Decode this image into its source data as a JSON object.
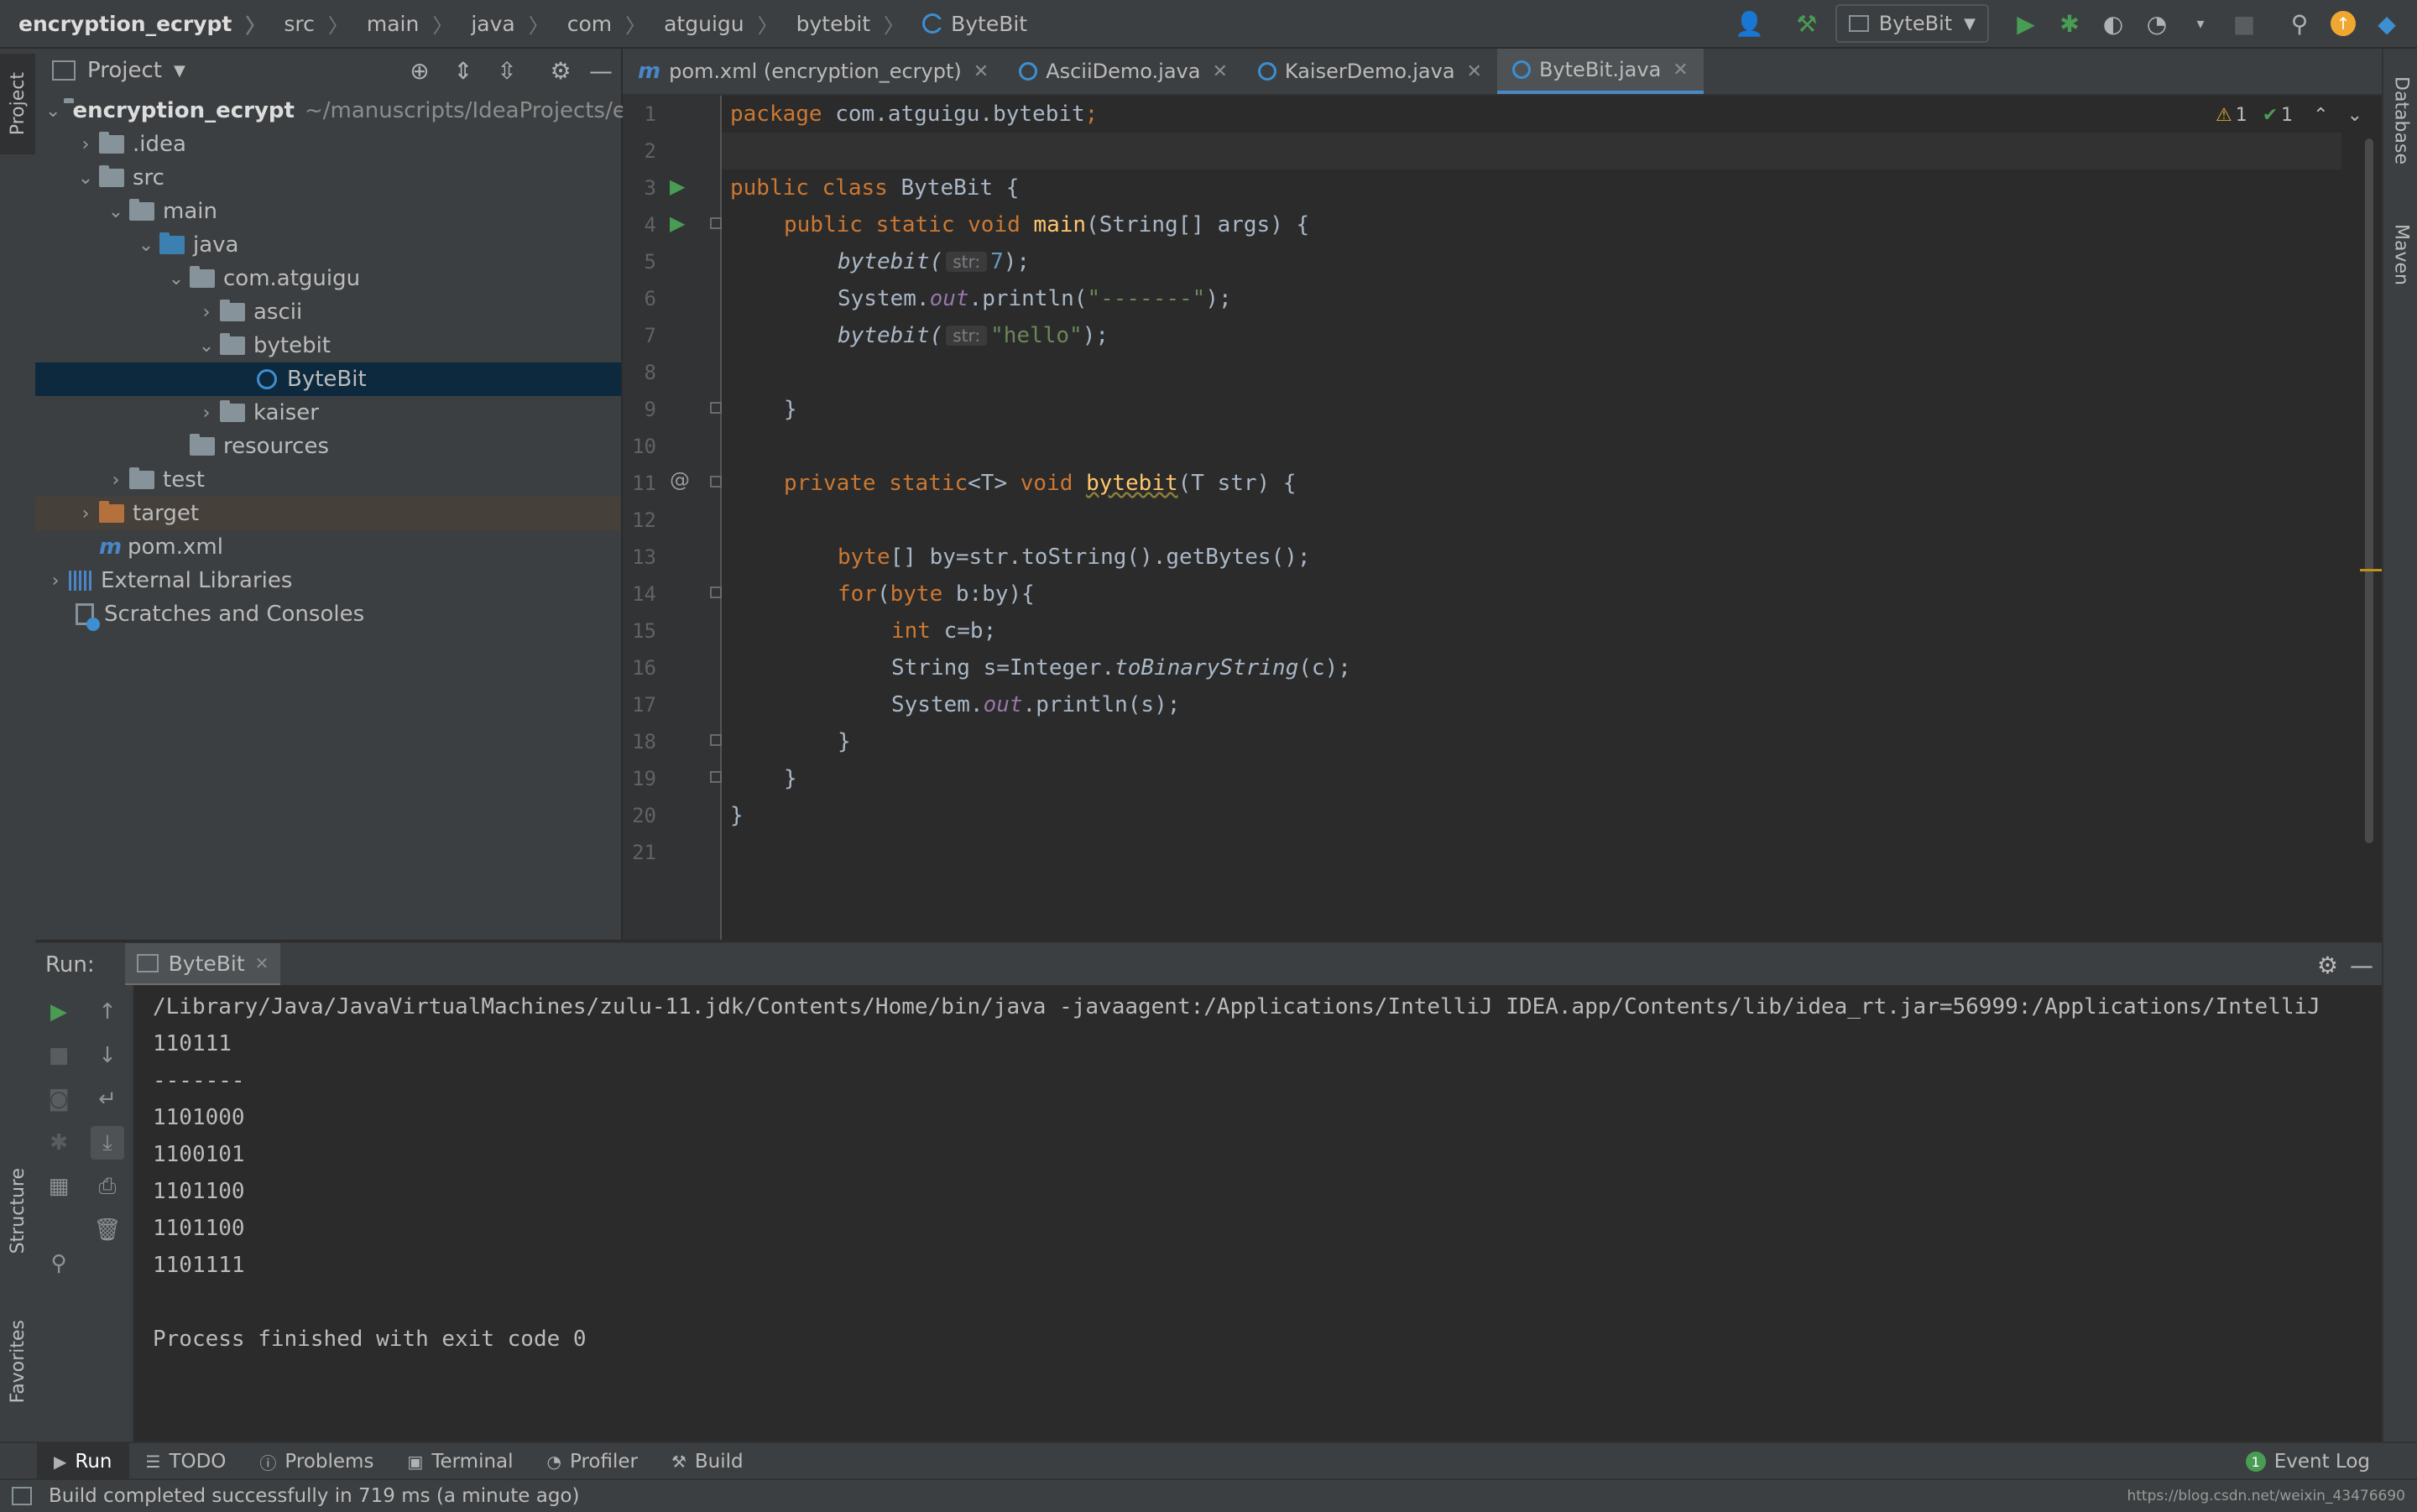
{
  "breadcrumbs": [
    "encryption_ecrypt",
    "src",
    "main",
    "java",
    "com",
    "atguigu",
    "bytebit",
    "ByteBit"
  ],
  "run_config": "ByteBit",
  "project_panel": {
    "title": "Project",
    "tree": [
      {
        "label": "encryption_ecrypt",
        "extra": "~/manuscripts/IdeaProjects/e"
      },
      {
        "label": ".idea"
      },
      {
        "label": "src"
      },
      {
        "label": "main"
      },
      {
        "label": "java"
      },
      {
        "label": "com.atguigu"
      },
      {
        "label": "ascii"
      },
      {
        "label": "bytebit"
      },
      {
        "label": "ByteBit"
      },
      {
        "label": "kaiser"
      },
      {
        "label": "resources"
      },
      {
        "label": "test"
      },
      {
        "label": "target"
      },
      {
        "label": "pom.xml"
      },
      {
        "label": "External Libraries"
      },
      {
        "label": "Scratches and Consoles"
      }
    ]
  },
  "editor_tabs": [
    {
      "label": "pom.xml (encryption_ecrypt)",
      "icon": "maven-icon"
    },
    {
      "label": "AsciiDemo.java",
      "icon": "class-icon"
    },
    {
      "label": "KaiserDemo.java",
      "icon": "class-icon"
    },
    {
      "label": "ByteBit.java",
      "icon": "class-icon",
      "active": true
    }
  ],
  "inspections": {
    "warnings": "1",
    "weak_warnings": "1"
  },
  "code": {
    "line_numbers": [
      "1",
      "2",
      "3",
      "4",
      "5",
      "6",
      "7",
      "8",
      "9",
      "10",
      "11",
      "12",
      "13",
      "14",
      "15",
      "16",
      "17",
      "18",
      "19",
      "20",
      "21"
    ],
    "l1_kw": "package ",
    "l1_rest": "com.atguigu.bytebit",
    "l1_semi": ";",
    "l3_kw": "public class ",
    "l3_rest": "ByteBit {",
    "l4_kw": "public static void ",
    "l4_fn": "main",
    "l4_rest": "(String[] args) {",
    "l5_fn": "bytebit(",
    "l5_hint": "str:",
    "l5_val": "7",
    "l5_end": ");",
    "l6_a": "System.",
    "l6_out": "out",
    "l6_b": ".println(",
    "l6_str": "\"-------\"",
    "l6_c": ");",
    "l7_fn": "bytebit(",
    "l7_hint": "str:",
    "l7_str": "\"hello\"",
    "l7_end": ");",
    "l9": "}",
    "l11_kw": "private static",
    "l11_t": "<T> ",
    "l11_kw2": "void ",
    "l11_fn": "bytebit",
    "l11_rest": "(T str) {",
    "l13_kw": "byte",
    "l13_rest": "[] by=str.toString().getBytes();",
    "l14_kw": "for",
    "l14_a": "(",
    "l14_kw2": "byte ",
    "l14_rest": "b:by){",
    "l15_kw": "int ",
    "l15_rest": "c=b;",
    "l16_a": "String s=Integer.",
    "l16_fn": "toBinaryString",
    "l16_b": "(c);",
    "l17_a": "System.",
    "l17_out": "out",
    "l17_b": ".println(s);",
    "l18": "}",
    "l19": "}",
    "l20": "}"
  },
  "run_panel": {
    "label": "Run:",
    "tab": "ByteBit",
    "output": [
      "/Library/Java/JavaVirtualMachines/zulu-11.jdk/Contents/Home/bin/java -javaagent:/Applications/IntelliJ IDEA.app/Contents/lib/idea_rt.jar=56999:/Applications/IntelliJ",
      "110111",
      "-------",
      "1101000",
      "1100101",
      "1101100",
      "1101100",
      "1101111",
      "",
      "Process finished with exit code 0"
    ]
  },
  "left_stripe": {
    "project": "Project",
    "structure": "Structure",
    "favorites": "Favorites"
  },
  "right_stripe": {
    "database": "Database",
    "maven": "Maven"
  },
  "bottom_tabs": [
    "Run",
    "TODO",
    "Problems",
    "Terminal",
    "Profiler",
    "Build"
  ],
  "event_log": {
    "count": "1",
    "label": "Event Log"
  },
  "status": {
    "message": "Build completed successfully in 719 ms (a minute ago)",
    "right": "https://blog.csdn.net/weixin_43476690"
  },
  "colors": {
    "accent": "#4a88c7",
    "run_green": "#499c54",
    "keyword": "#cc7832",
    "string": "#6a8759"
  }
}
